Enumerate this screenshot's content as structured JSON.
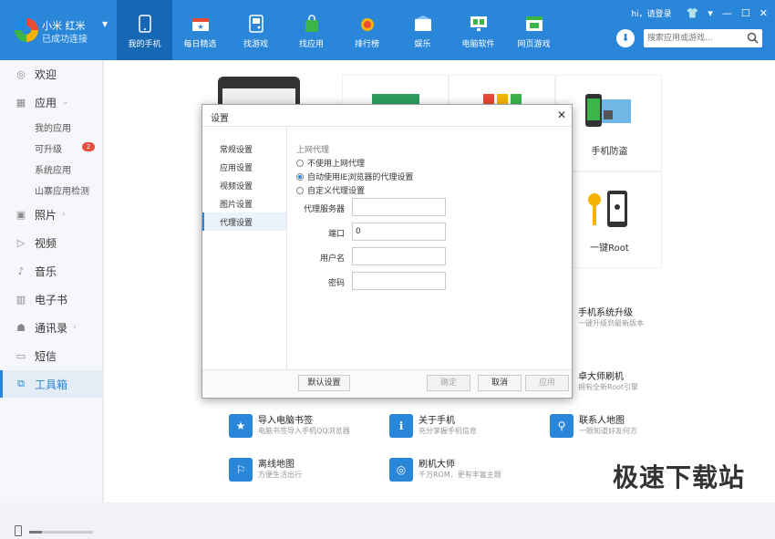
{
  "device": {
    "name": "小米 红米",
    "status": "已成功连接"
  },
  "nav": [
    {
      "label": "我的手机",
      "icon": "phone-icon"
    },
    {
      "label": "每日精选",
      "icon": "calendar-star-icon"
    },
    {
      "label": "找游戏",
      "icon": "gamepad-icon"
    },
    {
      "label": "找应用",
      "icon": "shopping-bag-icon"
    },
    {
      "label": "排行榜",
      "icon": "medal-icon"
    },
    {
      "label": "娱乐",
      "icon": "entertainment-icon"
    },
    {
      "label": "电脑软件",
      "icon": "monitor-icon"
    },
    {
      "label": "网页游戏",
      "icon": "web-game-icon"
    }
  ],
  "window": {
    "login": "hi，请登录",
    "skin": "👕",
    "menu": "▾",
    "minimize": "—",
    "maximize": "☐",
    "close": "✕"
  },
  "search": {
    "placeholder": "搜索应用或游戏..."
  },
  "sidebar": {
    "welcome": "欢迎",
    "apps": "应用",
    "my_apps": "我的应用",
    "upgradable": "可升级",
    "upgrade_count": "2",
    "system_apps": "系统应用",
    "copycat_check": "山寨应用检测",
    "photos": "照片",
    "video": "视频",
    "music": "音乐",
    "ebook": "电子书",
    "contacts": "通讯录",
    "sms": "短信",
    "toolbox": "工具箱"
  },
  "cards": {
    "anti_theft": "手机防盗",
    "root": "一键Root"
  },
  "tools": [
    {
      "title": "手机系统升级",
      "desc": "一键升级到最新版本",
      "icon": "⬆"
    },
    {
      "title": "卓大师刷机",
      "desc": "拥有全新Root引擎",
      "icon": "✦"
    },
    {
      "title": "导入电脑书签",
      "desc": "电脑书签导入手机QQ浏览器",
      "icon": "★"
    },
    {
      "title": "关于手机",
      "desc": "充分掌握手机信息",
      "icon": "ℹ"
    },
    {
      "title": "联系人地图",
      "desc": "一眼知道好友何方",
      "icon": "⚲"
    },
    {
      "title": "离线地图",
      "desc": "方便生活出行",
      "icon": "⚐"
    },
    {
      "title": "刷机大师",
      "desc": "千万ROM，更有丰富主题",
      "icon": "◎"
    }
  ],
  "dialog": {
    "title": "设置",
    "close": "✕",
    "nav": [
      "常规设置",
      "应用设置",
      "视频设置",
      "图片设置",
      "代理设置"
    ],
    "active_nav": 4,
    "section": "上网代理",
    "options": [
      "不使用上网代理",
      "自动使用IE浏览器的代理设置",
      "自定义代理设置"
    ],
    "selected_option": 1,
    "fields": [
      {
        "label": "代理服务器",
        "value": ""
      },
      {
        "label": "端口",
        "value": "0"
      },
      {
        "label": "用户名",
        "value": ""
      },
      {
        "label": "密码",
        "value": ""
      }
    ],
    "buttons": {
      "default": "默认设置",
      "ok": "确定",
      "cancel": "取消",
      "apply": "应用"
    }
  },
  "watermark": "极速下载站",
  "colors": {
    "accent": "#2a86d8",
    "topbar": "#2a86d8",
    "nav_active": "#1667b4",
    "badge": "#e74c3c"
  }
}
